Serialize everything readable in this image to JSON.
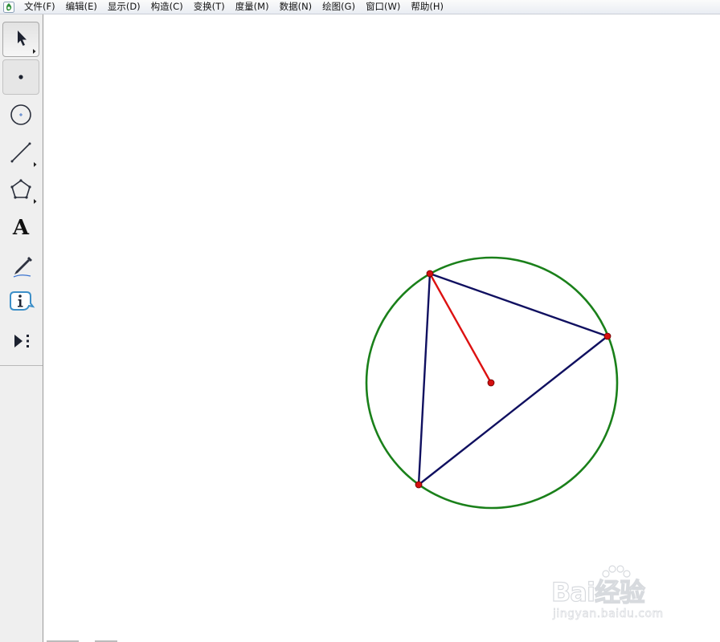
{
  "menubar": {
    "app_icon": "sketchpad-app-icon",
    "items": [
      {
        "label": "文件(F)"
      },
      {
        "label": "编辑(E)"
      },
      {
        "label": "显示(D)"
      },
      {
        "label": "构造(C)"
      },
      {
        "label": "变换(T)"
      },
      {
        "label": "度量(M)"
      },
      {
        "label": "数据(N)"
      },
      {
        "label": "绘图(G)"
      },
      {
        "label": "窗口(W)"
      },
      {
        "label": "帮助(H)"
      }
    ]
  },
  "toolbox": {
    "tools": [
      {
        "name": "selection-arrow-tool",
        "icon": "arrow-pointer-icon",
        "active": true
      },
      {
        "name": "point-tool",
        "icon": "point-icon"
      },
      {
        "name": "compass-tool",
        "icon": "circle-icon"
      },
      {
        "name": "straightedge-tool",
        "icon": "segment-icon"
      },
      {
        "name": "polygon-tool",
        "icon": "pentagon-icon"
      },
      {
        "name": "text-tool",
        "icon": "text-icon",
        "glyph": "A"
      },
      {
        "name": "marker-tool",
        "icon": "pen-marker-icon"
      },
      {
        "name": "information-tool",
        "icon": "info-icon"
      },
      {
        "name": "custom-tools",
        "icon": "play-more-icon"
      }
    ]
  },
  "colors": {
    "circle": "#1a801a",
    "triangle": "#101060",
    "radius": "#dd1111",
    "point": "#d40f0f"
  },
  "watermark": {
    "brand": "Bai经验",
    "url": "jingyan.baidu.com"
  }
}
